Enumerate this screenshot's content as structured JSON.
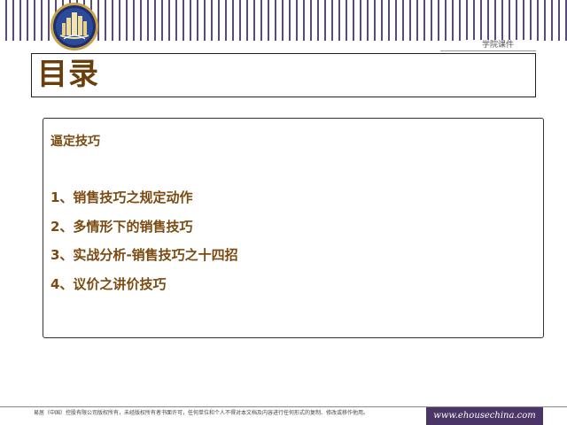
{
  "header": {
    "logo_icon": "academy-seal-logo",
    "subtitle": "学院课件",
    "stripe_color": "#5a4a78"
  },
  "title": "目录",
  "content": {
    "heading": "逼定技巧",
    "items": [
      "1、销售技巧之规定动作",
      "2、多情形下的销售技巧",
      "3、实战分析-销售技巧之十四招",
      "4、议价之讲价技巧"
    ],
    "text_color": "#7a4a10"
  },
  "footer": {
    "copyright": "易居（中国）控股有限公司版权所有，未经版权所有者书面许可，任何单位和个人不得对本文档及内容进行任何形式的复制、修改或移作他用。",
    "website": "www.ehousechina.com",
    "banner_color": "#4a3566"
  }
}
